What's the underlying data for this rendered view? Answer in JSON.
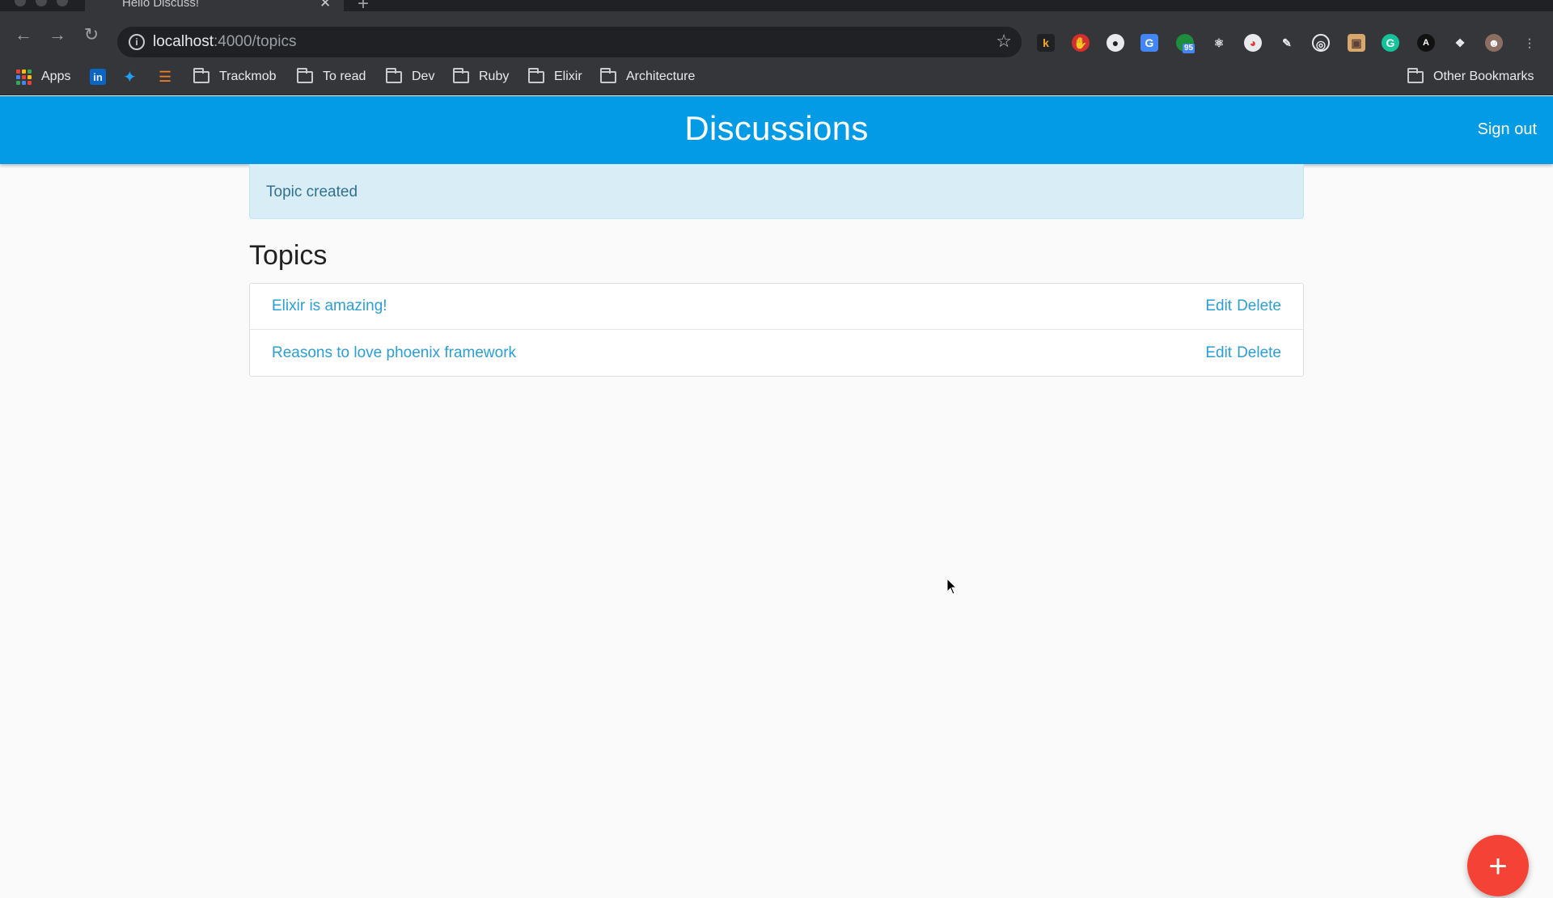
{
  "browser": {
    "tab_title": "Hello Discuss!",
    "tab_close": "✕",
    "new_tab": "+",
    "url_host": "localhost",
    "url_path": ":4000/topics",
    "bookmarks": {
      "apps": "Apps",
      "folders": [
        "Trackmob",
        "To read",
        "Dev",
        "Ruby",
        "Elixir",
        "Architecture"
      ],
      "other": "Other Bookmarks"
    },
    "extension_badge": "95"
  },
  "app": {
    "brand": "Discussions",
    "sign_out": "Sign out",
    "accent_color": "#039be5"
  },
  "flash": {
    "message": "Topic created"
  },
  "topics": {
    "heading": "Topics",
    "items": [
      {
        "title": "Elixir is amazing!",
        "edit": "Edit",
        "delete": "Delete"
      },
      {
        "title": "Reasons to love phoenix framework",
        "edit": "Edit",
        "delete": "Delete"
      }
    ]
  },
  "fab": {
    "label": "+",
    "color": "#f44336"
  }
}
